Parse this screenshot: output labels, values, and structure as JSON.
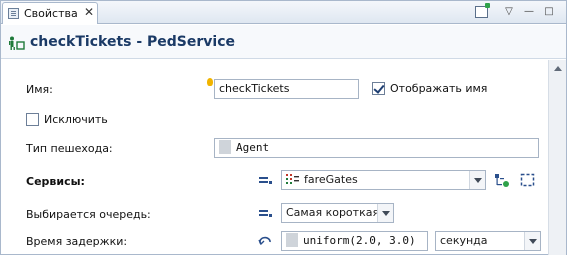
{
  "tab": {
    "label": "Свойства",
    "close": "✕"
  },
  "toolbar": {
    "view_menu": "▽",
    "minimize": "—",
    "maximize": "□"
  },
  "header": {
    "title": "checkTickets - PedService"
  },
  "form": {
    "name_label": "Имя:",
    "name_value": "checkTickets",
    "show_name_label": "Отображать имя",
    "show_name_checked": true,
    "exclude_label": "Исключить",
    "exclude_checked": false,
    "ped_type_label": "Тип пешехода:",
    "ped_type_value": "Agent",
    "services_label": "Сервисы:",
    "services_value": "fareGates",
    "queue_label": "Выбирается очередь:",
    "queue_value": "Самая короткая",
    "delay_label": "Время задержки:",
    "delay_value": "uniform(2.0, 3.0)",
    "delay_unit": "секунда"
  },
  "colors": {
    "title": "#1b3a66",
    "accent": "#2a4f8c",
    "border": "#a9b8cc"
  }
}
